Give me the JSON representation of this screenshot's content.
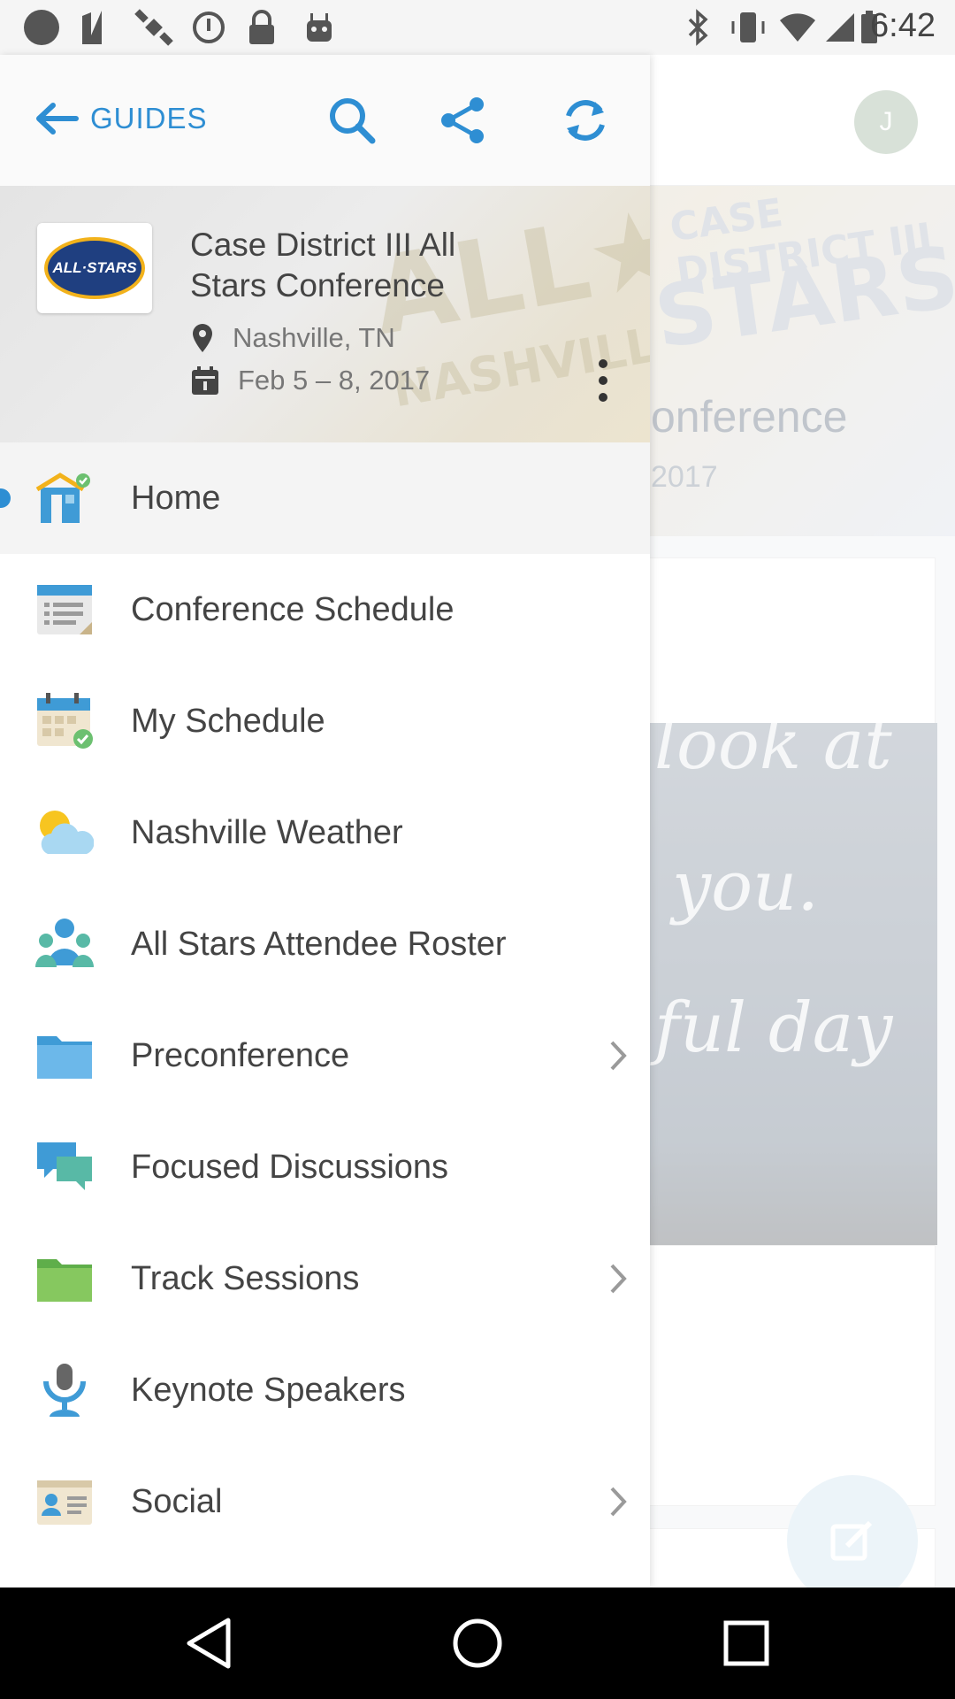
{
  "status_bar": {
    "time": "6:42",
    "left_icons": [
      "record-icon",
      "news-icon",
      "satellite-icon",
      "alarm-icon",
      "lock-icon",
      "android-icon"
    ],
    "right_icons": [
      "bluetooth-icon",
      "vibrate-icon",
      "wifi-icon",
      "signal-icon",
      "battery-icon"
    ]
  },
  "toolbar": {
    "back_label": "GUIDES",
    "accent_color": "#2e8ed3",
    "actions": [
      "search-icon",
      "share-icon",
      "refresh-icon"
    ]
  },
  "event": {
    "title": "Case District III All Stars Conference",
    "location": "Nashville, TN",
    "dates": "Feb 5 – 8, 2017",
    "logo_text": "ALL·STARS"
  },
  "menu": [
    {
      "label": "Home",
      "icon": "home-icon",
      "active": true,
      "has_submenu": false
    },
    {
      "label": "Conference Schedule",
      "icon": "schedule-list-icon",
      "active": false,
      "has_submenu": false
    },
    {
      "label": "My Schedule",
      "icon": "calendar-check-icon",
      "active": false,
      "has_submenu": false
    },
    {
      "label": "Nashville Weather",
      "icon": "weather-icon",
      "active": false,
      "has_submenu": false
    },
    {
      "label": "All Stars Attendee Roster",
      "icon": "people-icon",
      "active": false,
      "has_submenu": false
    },
    {
      "label": "Preconference",
      "icon": "folder-blue-icon",
      "active": false,
      "has_submenu": true
    },
    {
      "label": "Focused Discussions",
      "icon": "chat-bubbles-icon",
      "active": false,
      "has_submenu": false
    },
    {
      "label": "Track Sessions",
      "icon": "folder-green-icon",
      "active": false,
      "has_submenu": true
    },
    {
      "label": "Keynote Speakers",
      "icon": "microphone-icon",
      "active": false,
      "has_submenu": false
    },
    {
      "label": "Social",
      "icon": "contact-card-icon",
      "active": false,
      "has_submenu": true
    }
  ],
  "background": {
    "avatar_initial": "J",
    "banner_title": "onference",
    "banner_date": "2017"
  },
  "nav_bar": [
    "back-icon",
    "home-icon",
    "recents-icon"
  ]
}
